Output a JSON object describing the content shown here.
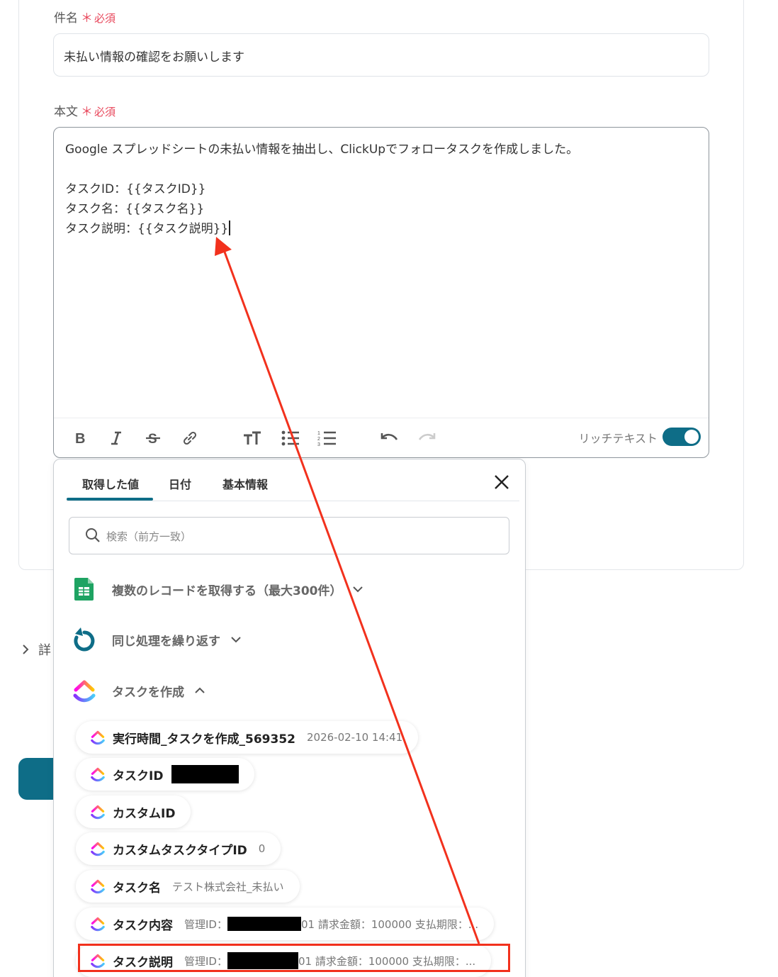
{
  "subject": {
    "label": "件名",
    "required_mark": "＊",
    "required_text": "必須",
    "value": "未払い情報の確認をお願いします"
  },
  "body": {
    "label": "本文",
    "required_mark": "＊",
    "required_text": "必須",
    "lines": [
      "Google スプレッドシートの未払い情報を抽出し、ClickUpでフォロータスクを作成しました。",
      "",
      "タスクID：{{タスクID}}",
      "タスク名：{{タスク名}}",
      "タスク説明：{{タスク説明}}"
    ]
  },
  "toolbar": {
    "rich_text_label": "リッチテキスト",
    "rich_text_enabled": true,
    "icons": [
      "bold-icon",
      "italic-icon",
      "strikethrough-icon",
      "link-icon",
      "text-size-icon",
      "bullet-list-icon",
      "numbered-list-icon",
      "undo-icon",
      "redo-icon"
    ]
  },
  "details_label": "詳",
  "popup": {
    "tabs": [
      "取得した値",
      "日付",
      "基本情報"
    ],
    "active_tab": 0,
    "search_placeholder": "検索（前方一致）",
    "groups": [
      {
        "icon": "google-sheets-icon",
        "label": "複数のレコードを取得する（最大300件）",
        "expanded": false
      },
      {
        "icon": "loop-icon",
        "label": "同じ処理を繰り返す",
        "expanded": false
      },
      {
        "icon": "clickup-icon",
        "label": "タスクを作成",
        "expanded": true
      }
    ],
    "items": [
      {
        "label": "実行時間_タスクを作成_569352",
        "value": "2026-02-10 14:41"
      },
      {
        "label": "タスクID",
        "value": ""
      },
      {
        "label": "カスタムID",
        "value": ""
      },
      {
        "label": "カスタムタスクタイプID",
        "value": "0"
      },
      {
        "label": "タスク名",
        "value": "テスト株式会社_未払い"
      },
      {
        "label": "タスク内容",
        "value_prefix": "管理ID：",
        "value_suffix": "01 請求金額：100000 支払期限：..."
      },
      {
        "label": "タスク説明",
        "value_prefix": "管理ID：",
        "value_suffix": "01 請求金額：100000 支払期限：..."
      }
    ]
  },
  "colors": {
    "accent": "#0e6d87",
    "required": "#e8475b",
    "annotation": "#f2311d"
  }
}
